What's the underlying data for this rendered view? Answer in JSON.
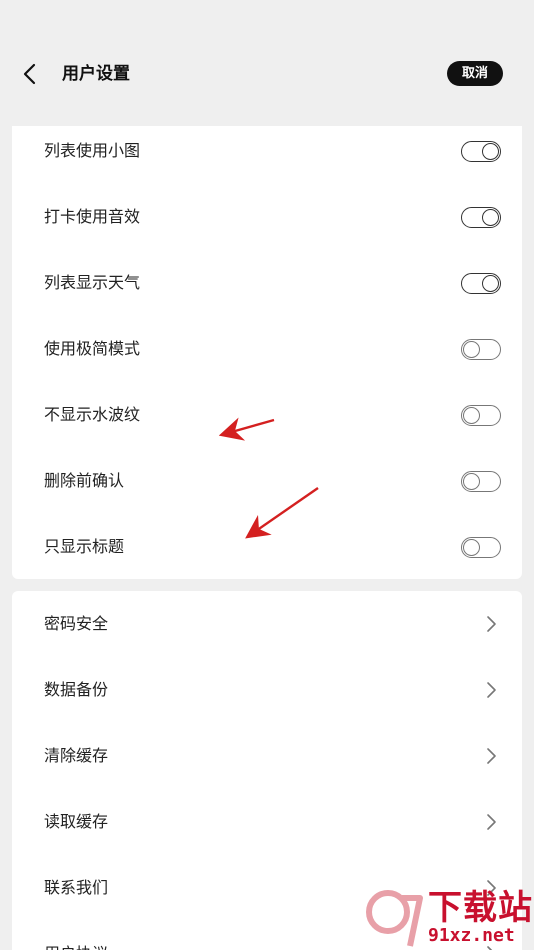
{
  "header": {
    "title": "用户设置",
    "cancel_label": "取消"
  },
  "toggles": [
    {
      "label": "列表使用小图",
      "on": true
    },
    {
      "label": "打卡使用音效",
      "on": true
    },
    {
      "label": "列表显示天气",
      "on": true
    },
    {
      "label": "使用极简模式",
      "on": false
    },
    {
      "label": "不显示水波纹",
      "on": false
    },
    {
      "label": "删除前确认",
      "on": false
    },
    {
      "label": "只显示标题",
      "on": false
    }
  ],
  "nav": [
    {
      "label": "密码安全"
    },
    {
      "label": "数据备份"
    },
    {
      "label": "清除缓存"
    },
    {
      "label": "读取缓存"
    },
    {
      "label": "联系我们"
    },
    {
      "label": "用户协议"
    }
  ],
  "watermark": {
    "top": "下载站",
    "bottom": "91xz.net"
  },
  "colors": {
    "background": "#efefef",
    "card": "#ffffff",
    "annotation_arrow": "#d42020",
    "watermark": "#c8102e"
  }
}
